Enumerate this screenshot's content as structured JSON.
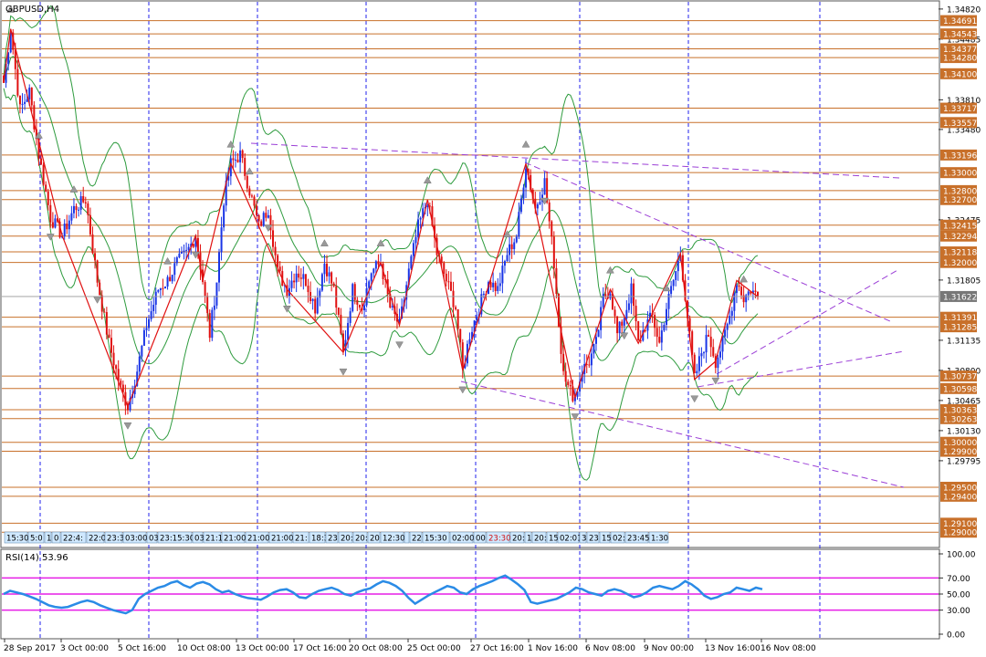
{
  "symbol_label": "GBPUSD,H4",
  "rsi_label": "RSI(14) 53.96",
  "colors": {
    "background": "#ffffff",
    "bull": "#1a35e6",
    "bear": "#e01010",
    "bands": "#2e9b3e",
    "level_line": "#c8702a",
    "level_label_bg": "#c8702a",
    "price_label_bg": "#777777",
    "trend": "#9b3fd6",
    "zigzag": "#e01010",
    "rsi": "#2a8be6",
    "rsi_levels": "#e61ee6",
    "vgrid": "#2222ee",
    "session_box": "#cfe8ff"
  },
  "chart_data": {
    "type": "candlestick",
    "series_name": "GBPUSD,H4",
    "price_axis_ticks": [
      "1.34820",
      "1.34485",
      "1.33810",
      "1.33480",
      "1.32475",
      "1.31805",
      "1.31135",
      "1.30800",
      "1.30465",
      "1.30130",
      "1.29795"
    ],
    "horizontal_levels": [
      "1.34691",
      "1.34543",
      "1.34377",
      "1.34280",
      "1.34100",
      "1.33717",
      "1.33557",
      "1.33196",
      "1.33000",
      "1.32800",
      "1.32700",
      "1.32415",
      "1.32294",
      "1.32118",
      "1.32000",
      "1.31391",
      "1.31285",
      "1.30737",
      "1.30598",
      "1.30363",
      "1.30263",
      "1.30000",
      "1.29900",
      "1.29500",
      "1.29400",
      "1.29100",
      "1.29000"
    ],
    "current_price_label": "1.31622",
    "ylim": [
      1.2885,
      1.349
    ],
    "date_labels": [
      "28 Sep 2017",
      "3 Oct 00:00",
      "5 Oct 16:00",
      "10 Oct 08:00",
      "13 Oct 00:00",
      "17 Oct 16:00",
      "20 Oct 08:00",
      "25 Oct 00:00",
      "27 Oct 16:00",
      "1 Nov 16:00",
      "6 Nov 08:00",
      "9 Nov 00:00",
      "13 Nov 16:00",
      "16 Nov 08:00"
    ],
    "session_labels": [
      "15:30",
      "5:0",
      "1",
      "0",
      "22:4:",
      "22:0",
      "23:3",
      "03:00",
      "03",
      "23:15:30",
      "03",
      "21:1",
      "21:00",
      "21:00",
      "21:00",
      "21:",
      "18:3",
      "23",
      "20:",
      "20:",
      "20",
      "12:30",
      "",
      "22:",
      "15:30",
      "02:00",
      "00",
      "23:30",
      "20:",
      "1",
      "20:",
      "15",
      "02:01",
      "3",
      "23",
      "15",
      "02:",
      "23:45",
      "1:30"
    ],
    "price_path": [
      [
        0,
        1.34
      ],
      [
        3,
        1.346
      ],
      [
        7,
        1.337
      ],
      [
        11,
        1.339
      ],
      [
        15,
        1.332
      ],
      [
        20,
        1.325
      ],
      [
        25,
        1.323
      ],
      [
        30,
        1.326
      ],
      [
        35,
        1.327
      ],
      [
        40,
        1.318
      ],
      [
        45,
        1.311
      ],
      [
        50,
        1.306
      ],
      [
        53,
        1.304
      ],
      [
        57,
        1.308
      ],
      [
        61,
        1.313
      ],
      [
        66,
        1.317
      ],
      [
        70,
        1.318
      ],
      [
        74,
        1.32
      ],
      [
        78,
        1.321
      ],
      [
        82,
        1.323
      ],
      [
        85,
        1.318
      ],
      [
        88,
        1.312
      ],
      [
        91,
        1.318
      ],
      [
        94,
        1.327
      ],
      [
        97,
        1.331
      ],
      [
        101,
        1.332
      ],
      [
        105,
        1.328
      ],
      [
        109,
        1.324
      ],
      [
        113,
        1.326
      ],
      [
        117,
        1.319
      ],
      [
        121,
        1.317
      ],
      [
        125,
        1.319
      ],
      [
        129,
        1.318
      ],
      [
        133,
        1.315
      ],
      [
        137,
        1.32
      ],
      [
        141,
        1.317
      ],
      [
        145,
        1.31
      ],
      [
        149,
        1.317
      ],
      [
        153,
        1.315
      ],
      [
        157,
        1.319
      ],
      [
        161,
        1.32
      ],
      [
        165,
        1.315
      ],
      [
        169,
        1.313
      ],
      [
        173,
        1.319
      ],
      [
        177,
        1.324
      ],
      [
        181,
        1.327
      ],
      [
        185,
        1.321
      ],
      [
        189,
        1.318
      ],
      [
        193,
        1.315
      ],
      [
        196,
        1.308
      ],
      [
        199,
        1.312
      ],
      [
        203,
        1.315
      ],
      [
        207,
        1.318
      ],
      [
        211,
        1.317
      ],
      [
        215,
        1.321
      ],
      [
        219,
        1.323
      ],
      [
        223,
        1.331
      ],
      [
        227,
        1.326
      ],
      [
        231,
        1.329
      ],
      [
        235,
        1.32
      ],
      [
        238,
        1.31
      ],
      [
        241,
        1.306
      ],
      [
        244,
        1.305
      ],
      [
        247,
        1.308
      ],
      [
        250,
        1.309
      ],
      [
        253,
        1.311
      ],
      [
        256,
        1.316
      ],
      [
        259,
        1.317
      ],
      [
        262,
        1.312
      ],
      [
        265,
        1.314
      ],
      [
        268,
        1.317
      ],
      [
        271,
        1.311
      ],
      [
        274,
        1.313
      ],
      [
        277,
        1.314
      ],
      [
        280,
        1.311
      ],
      [
        283,
        1.315
      ],
      [
        286,
        1.318
      ],
      [
        289,
        1.321
      ],
      [
        292,
        1.314
      ],
      [
        295,
        1.307
      ],
      [
        298,
        1.31
      ],
      [
        301,
        1.312
      ],
      [
        304,
        1.309
      ],
      [
        307,
        1.311
      ],
      [
        310,
        1.314
      ],
      [
        313,
        1.318
      ],
      [
        316,
        1.316
      ],
      [
        319,
        1.317
      ],
      [
        322,
        1.3162
      ]
    ],
    "rsi": {
      "levels": [
        70,
        50,
        30
      ],
      "axis_ticks": [
        "100.00",
        "70.00",
        "50.00",
        "30.00",
        "0.00"
      ],
      "ylim": [
        0,
        100
      ],
      "values": [
        50,
        54,
        52,
        50,
        47,
        44,
        40,
        36,
        34,
        33,
        34,
        37,
        40,
        42,
        40,
        36,
        33,
        30,
        28,
        26,
        30,
        44,
        50,
        54,
        58,
        60,
        64,
        66,
        61,
        58,
        63,
        65,
        62,
        56,
        52,
        54,
        50,
        47,
        45,
        44,
        43,
        47,
        52,
        55,
        56,
        52,
        46,
        45,
        50,
        54,
        56,
        58,
        55,
        50,
        48,
        52,
        55,
        57,
        62,
        66,
        64,
        60,
        54,
        45,
        38,
        43,
        48,
        52,
        56,
        60,
        58,
        52,
        50,
        56,
        60,
        63,
        66,
        70,
        73,
        68,
        62,
        55,
        40,
        38,
        40,
        42,
        44,
        48,
        52,
        58,
        56,
        52,
        50,
        48,
        54,
        56,
        54,
        50,
        46,
        48,
        52,
        58,
        60,
        58,
        56,
        60,
        66,
        62,
        56,
        48,
        44,
        46,
        50,
        52,
        58,
        56,
        54,
        58,
        56
      ]
    },
    "annotations": [
      "Bollinger bands",
      "trendlines",
      "zigzag",
      "fractals"
    ]
  }
}
